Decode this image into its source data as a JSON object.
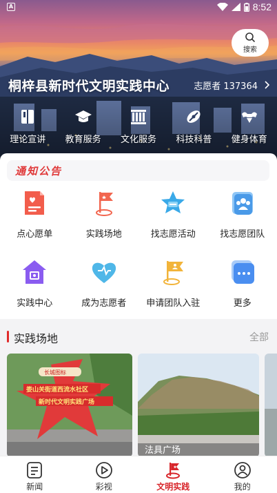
{
  "status_bar": {
    "time": "8:52"
  },
  "header": {
    "search_label": "搜索",
    "title": "桐梓县新时代文明实践中心",
    "volunteers": "志愿者 137364"
  },
  "hero_nav": [
    {
      "label": "理论宣讲",
      "icon": "book-icon"
    },
    {
      "label": "教育服务",
      "icon": "graduation-cap-icon"
    },
    {
      "label": "文化服务",
      "icon": "library-icon"
    },
    {
      "label": "科技科普",
      "icon": "satellite-icon"
    },
    {
      "label": "健身体育",
      "icon": "fitness-icon"
    }
  ],
  "notice": {
    "label": "通知公告"
  },
  "services": [
    {
      "label": "点心愿单",
      "icon": "wish-list-icon",
      "color": "#f25d4c"
    },
    {
      "label": "实践场地",
      "icon": "flag-location-icon",
      "color": "#f2664f"
    },
    {
      "label": "找志愿活动",
      "icon": "star-chat-icon",
      "color": "#3aa9e8"
    },
    {
      "label": "找志愿团队",
      "icon": "team-icon",
      "color": "#4a9ae8"
    },
    {
      "label": "实践中心",
      "icon": "house-icon",
      "color": "#8a5cf0"
    },
    {
      "label": "成为志愿者",
      "icon": "heart-icon",
      "color": "#4fb7e8"
    },
    {
      "label": "申请团队入驻",
      "icon": "flag-team-icon",
      "color": "#f2b43a"
    },
    {
      "label": "更多",
      "icon": "more-icon",
      "color": "#4a8ef0"
    }
  ],
  "section": {
    "title": "实践场地",
    "more": "全部"
  },
  "cards": [
    {
      "sign_top": "长城图标",
      "sign_line1": "娄山关街道西流水社区",
      "sign_line2": "新时代文明实践广场"
    },
    {
      "caption": "法具广场"
    }
  ],
  "tabbar": [
    {
      "label": "新闻",
      "icon": "news-icon",
      "active": false
    },
    {
      "label": "彩视",
      "icon": "play-icon",
      "active": false
    },
    {
      "label": "文明实践",
      "icon": "civilization-icon",
      "active": true
    },
    {
      "label": "我的",
      "icon": "profile-icon",
      "active": false
    }
  ],
  "colors": {
    "accent": "#d8262b",
    "section_bar": "#e02a2a",
    "notice_text": "#e03a3a"
  }
}
